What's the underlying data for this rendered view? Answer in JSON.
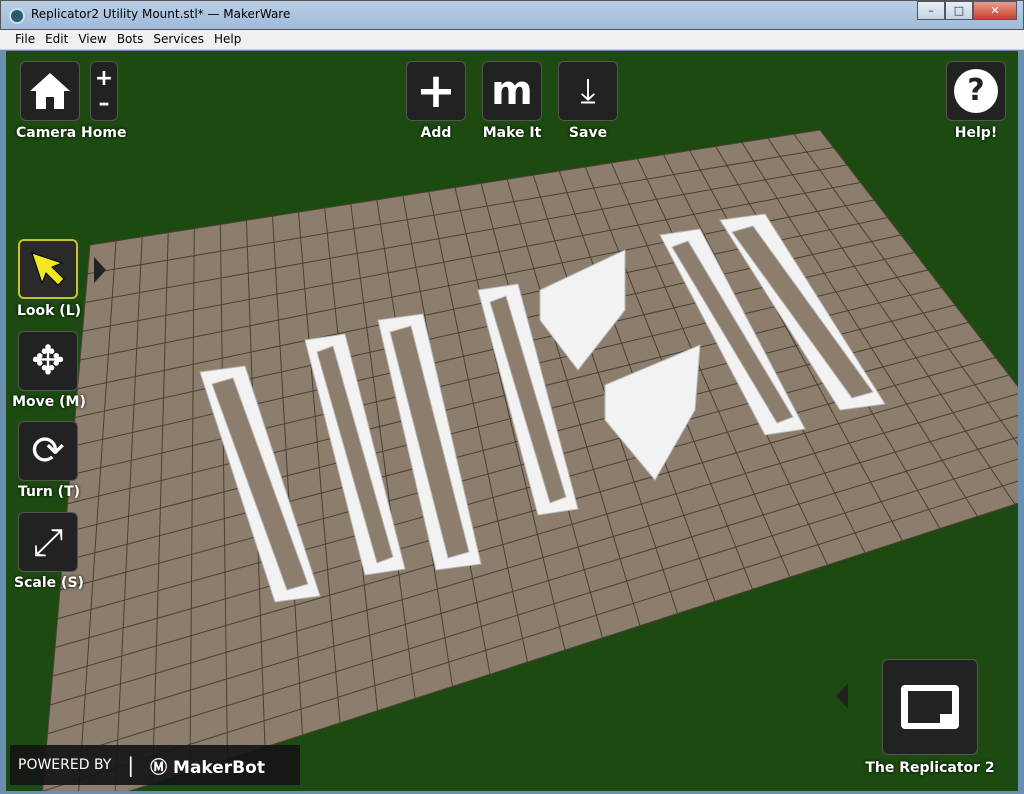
{
  "window": {
    "title": "Replicator2 Utility Mount.stl* — MakerWare",
    "minimize": "–",
    "maximize": "□",
    "close": "✕"
  },
  "menu": [
    "File",
    "Edit",
    "View",
    "Bots",
    "Services",
    "Help"
  ],
  "toolbar": {
    "camera_home": "Camera Home",
    "zoom_in": "+",
    "zoom_out": "–",
    "add": "Add",
    "make_it": "Make It",
    "save": "Save",
    "help": "Help!"
  },
  "tools": {
    "look": "Look (L)",
    "move": "Move (M)",
    "turn": "Turn (T)",
    "scale": "Scale (S)"
  },
  "footer": {
    "powered_by": "POWERED BY",
    "brand": "MakerBot"
  },
  "printer": {
    "name": "The Replicator 2"
  },
  "colors": {
    "background": "#1c4a10",
    "plate": "#8c7d6c",
    "active": "#e8e020"
  }
}
